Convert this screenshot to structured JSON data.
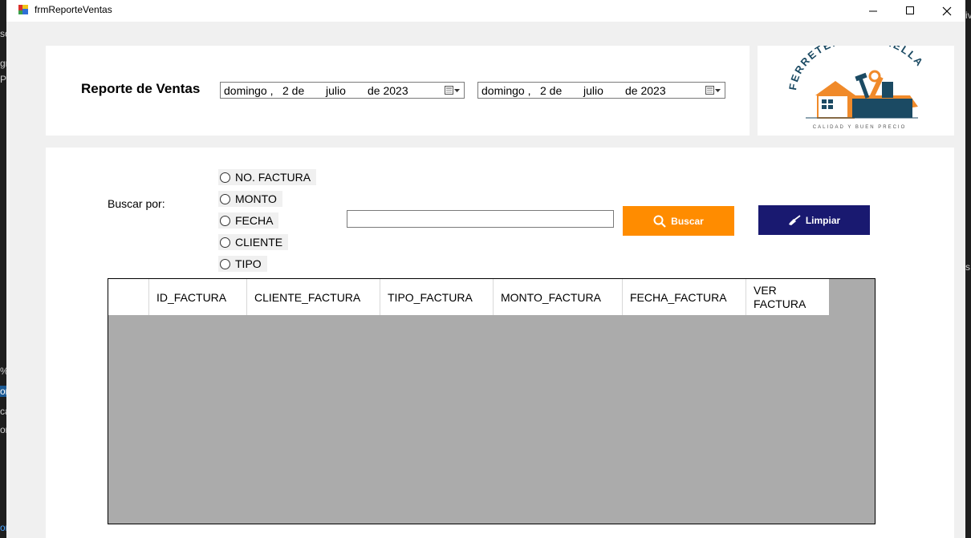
{
  "window": {
    "title": "frmReporteVentas"
  },
  "background_fragments": [
    "so:",
    "gra",
    "Pro",
    "%",
    "on",
    "ca",
    "on",
    "on",
    "iv",
    "s"
  ],
  "header": {
    "title": "Reporte de Ventas",
    "date_from": {
      "weekday": "domingo ,",
      "day": "2 de",
      "month": "julio",
      "year": "de 2023"
    },
    "date_to": {
      "weekday": "domingo ,",
      "day": "2 de",
      "month": "julio",
      "year": "de 2023"
    }
  },
  "logo": {
    "brand": "FERRETERÍA ESTRELLA",
    "tagline": "CALIDAD Y BUEN PRECIO",
    "colors": {
      "navy": "#1b4a63",
      "orange": "#f08a2a"
    }
  },
  "search": {
    "label": "Buscar por:",
    "options": [
      "NO. FACTURA",
      "MONTO",
      "FECHA",
      "CLIENTE",
      "TIPO"
    ],
    "input_value": "",
    "search_button": "Buscar",
    "clear_button": "Limpiar",
    "colors": {
      "search_button": "#ff8c00",
      "clear_button": "#191970"
    }
  },
  "grid": {
    "columns": [
      "ID_FACTURA",
      "CLIENTE_FACTURA",
      "TIPO_FACTURA",
      "MONTO_FACTURA",
      "FECHA_FACTURA",
      "VER FACTURA"
    ],
    "rows": []
  }
}
